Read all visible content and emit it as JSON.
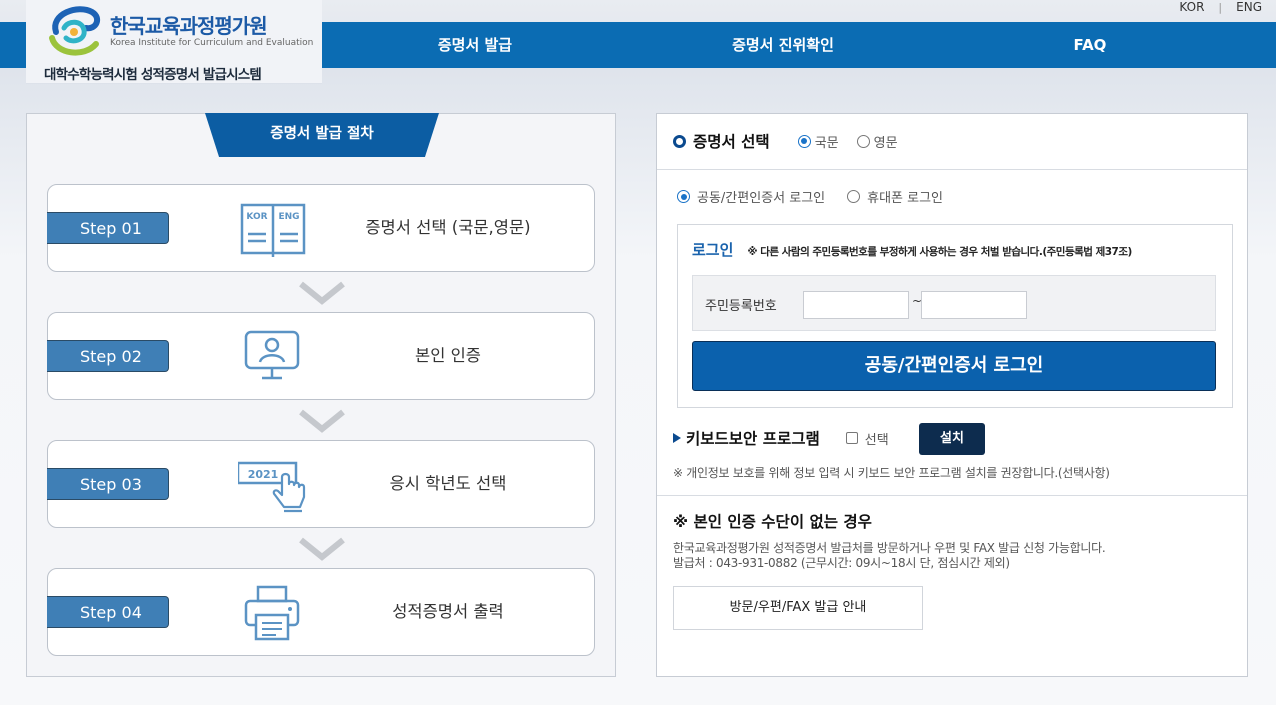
{
  "header": {
    "lang": {
      "kor": "KOR",
      "sep": "|",
      "eng": "ENG"
    },
    "logo_name_ko": "한국교육과정평가원",
    "logo_name_en": "Korea Institute for Curriculum and Evaluation",
    "system_title": "대학수학능력시험 성적증명서 발급시스템",
    "nav": [
      {
        "label": "증명서 발급"
      },
      {
        "label": "증명서 진위확인"
      },
      {
        "label": "FAQ"
      }
    ]
  },
  "process": {
    "tab_title": "증명서 발급 절차",
    "steps": [
      {
        "badge": "Step 01",
        "text": "증명서 선택 (국문,영문)",
        "icon": "book-icon",
        "icon_text_left": "KOR",
        "icon_text_right": "ENG"
      },
      {
        "badge": "Step 02",
        "text": "본인 인증",
        "icon": "monitor-user-icon"
      },
      {
        "badge": "Step 03",
        "text": "응시 학년도 선택",
        "icon": "year-click-icon",
        "icon_text": "2021"
      },
      {
        "badge": "Step 04",
        "text": "성적증명서 출력",
        "icon": "printer-icon"
      }
    ]
  },
  "certificate": {
    "title": "증명서 선택",
    "options": [
      {
        "label": "국문",
        "selected": true
      },
      {
        "label": "영문",
        "selected": false
      }
    ]
  },
  "login_method": {
    "options": [
      {
        "label": "공동/간편인증서 로그인",
        "selected": true
      },
      {
        "label": "휴대폰 로그인",
        "selected": false
      }
    ]
  },
  "login": {
    "title": "로그인",
    "warning": "※ 다른 사람의 주민등록번호를 부정하게 사용하는 경우 처벌 받습니다.(주민등록법 제37조)",
    "rrn_label": "주민등록번호",
    "rrn_first": "",
    "rrn_sep": "~",
    "rrn_second": "",
    "button": "공동/간편인증서 로그인"
  },
  "keyboard": {
    "title": "키보드보안 프로그램",
    "checkbox_label": "선택",
    "checked": false,
    "install_button": "설치",
    "note": "※ 개인정보 보호를 위해 정보 입력 시 키보드 보안 프로그램 설치를 권장합니다.(선택사항)"
  },
  "no_auth": {
    "title": "※ 본인 인증 수단이 없는 경우",
    "line1": "한국교육과정평가원 성적증명서 발급처를 방문하거나 우편 및 FAX 발급 신청 가능합니다.",
    "line2": "발급처 : 043-931-0882 (근무시간: 09시~18시 단, 점심시간 제외)",
    "button": "방문/우편/FAX 발급 안내"
  },
  "colors": {
    "nav_blue": "#0b6cb3",
    "tab_blue": "#0c5da3",
    "step_badge": "#3f7fb6",
    "login_button": "#0b61ad",
    "install_button": "#0d2c4e",
    "icon_stroke": "#5b93c4"
  }
}
